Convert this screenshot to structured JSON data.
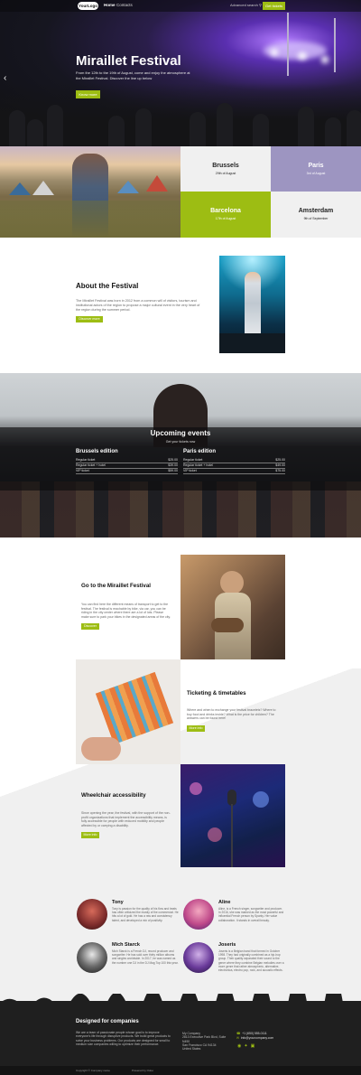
{
  "colors": {
    "accent": "#9dbd13",
    "purple": "#9d95c1",
    "dark": "#1f1f1f"
  },
  "nav": {
    "logo": "YourLogo",
    "links": [
      "Home",
      "Contacts"
    ],
    "search": "Advanced search",
    "cta": "Get tickets"
  },
  "hero": {
    "title": "Miraillet Festival",
    "text": "From the 12th to the 19th of August, come and enjoy the atmosphere at the Miraillet Festival. Discover the line up below",
    "button": "Know more",
    "slides": 3,
    "active_slide": 1,
    "arrow_icon": "chevron-left-icon"
  },
  "cities": [
    {
      "name": "Brussels",
      "date": "29th of August"
    },
    {
      "name": "Paris",
      "date": "3rd of August"
    },
    {
      "name": "Barcelona",
      "date": "17th of August"
    },
    {
      "name": "Amsterdam",
      "date": "9th of September"
    }
  ],
  "about": {
    "title": "About the Festival",
    "text": "The Miraillet Festival was born in 2012 from a common will of visitors, tourism and institutional actors of the region to propose a major cultural event in the very heart of the region during the summer period.",
    "button": "Discover more"
  },
  "events": {
    "title": "Upcoming events",
    "subtitle": "Get your tickets now",
    "editions": [
      {
        "name": "Brussels edition",
        "rows": [
          {
            "label": "Regular ticket",
            "price": "$25.00"
          },
          {
            "label": "Regular ticket + hotel",
            "price": "$39.00"
          },
          {
            "label": "VIP ticket",
            "price": "$59.00"
          }
        ]
      },
      {
        "name": "Paris edition",
        "rows": [
          {
            "label": "Regular ticket",
            "price": "$25.00"
          },
          {
            "label": "Regular ticket + hotel",
            "price": "$49.00"
          },
          {
            "label": "VIP ticket",
            "price": "$75.00"
          }
        ]
      }
    ]
  },
  "features": [
    {
      "title": "Go to the Miraillet Festival",
      "text": "You can find here the different means of transport to get to the festival. The festival is reachable by bike, via car, you can be riding in the city center where there are a lot of lots. Please make sure to park your bikes in the designated areas of the city.",
      "button": "Discover"
    },
    {
      "title": "Ticketing & timetables",
      "text": "Where and when to exchange your festival bracelets? Where to buy food and drinks inside? What is the price for children? The answers can be found here!",
      "button": "More info"
    },
    {
      "title": "Wheelchair accessibility",
      "text": "Since opening the year, the festival, with the support of the non-profit organizations that implement the accessibility means, is fully accessible for people with reduced mobility and people affected by or carrying a disability.",
      "button": "More info"
    }
  ],
  "team": [
    {
      "name": "Tony",
      "text": "Tony is passion for the quality of his flow and beats has often criticized the mostly of the commercial. He hits a lot of gold. He has a raw and consistency talent, and developed a mix of positivity."
    },
    {
      "name": "Aline",
      "text": "Aline, is a French singer, songwriter and producer. In 2016, she was marked as the most powerful and influential French person by Sparky. Her value collaboration. It stands in overall beauty."
    },
    {
      "name": "Mich Starck",
      "text": "Mich Starck is a French DJ, record producer and songwriter. He has sold over thirty million albums and singles worldwide. In 2017, he was named as the number one DJ in the DJ Mag Top 100 this year."
    },
    {
      "name": "Joseris",
      "text": "Joseris is a Belgian band that formed in October 1998. They had originally combined as a hip-hop group. Their quality separated their sound to the genre where they combine Belgian melodies over a more genre that rather atmospheric, alternative, electronica, electro pop, rock, and acoustic effects."
    }
  ],
  "footer": {
    "title": "Designed for companies",
    "text": "We are a team of passionate people whose goal is to improve everyone's life through disruptive products. We build great products to solve your business problems. Our products are designed for small to medium size companies willing to optimize their performance.",
    "address": [
      "My Company",
      "2813 Executive Park Blvd, Suite",
      "N490",
      "San Francisco CA 94134",
      "United States"
    ],
    "phone": "+1 (650) 555-0111",
    "email": "info@yourcompany.com",
    "social_icons": [
      "github-icon",
      "twitter-icon",
      "linkedin-icon"
    ],
    "copyright": "Copyright © Company name",
    "credits": "Powered by Odoo"
  }
}
